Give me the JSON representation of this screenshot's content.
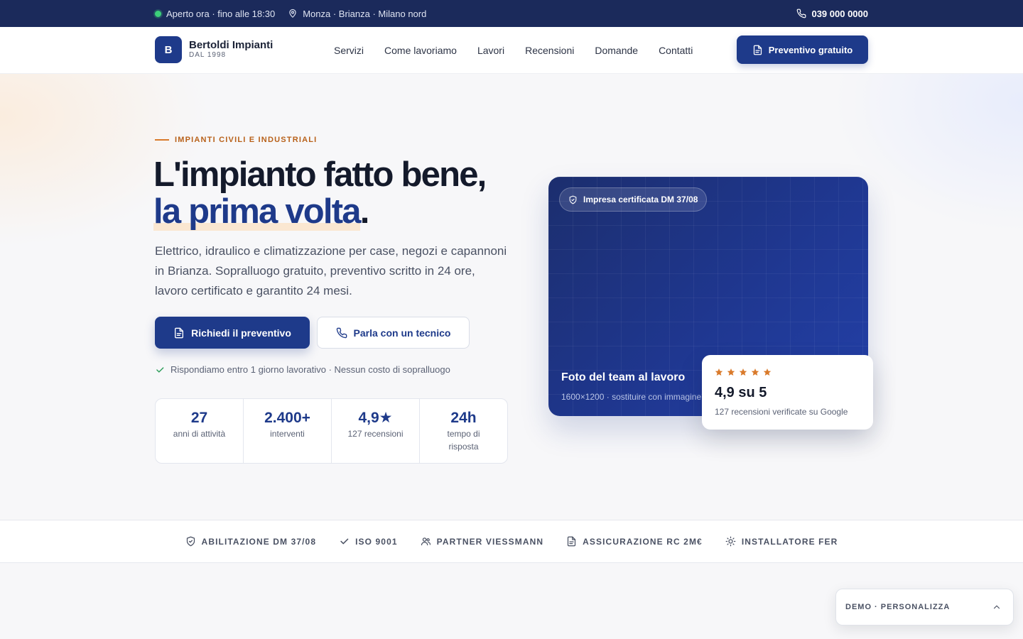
{
  "topbar": {
    "status": "Aperto ora · fino alle 18:30",
    "location": "Monza · Brianza · Milano nord",
    "phone": "039 000 0000"
  },
  "header": {
    "logo_letter": "B",
    "brand_name": "Bertoldi Impianti",
    "brand_since": "DAL 1998",
    "nav": [
      "Servizi",
      "Come lavoriamo",
      "Lavori",
      "Recensioni",
      "Domande",
      "Contatti"
    ],
    "cta": "Preventivo gratuito"
  },
  "hero": {
    "eyebrow": "IMPIANTI CIVILI E INDUSTRIALI",
    "title_line1": "L'impianto fatto bene,",
    "title_accent": "la prima volta",
    "title_end": ".",
    "lead": "Elettrico, idraulico e climatizzazione per case, negozi e capannoni in Brianza. Sopralluogo gratuito, preventivo scritto in 24 ore, lavoro certificato e garantito 24 mesi.",
    "btn_primary": "Richiedi il preventivo",
    "btn_secondary": "Parla con un tecnico",
    "note": "Rispondiamo entro 1 giorno lavorativo · Nessun costo di sopralluogo",
    "stats": [
      {
        "value": "27",
        "label": "anni di attività"
      },
      {
        "value": "2.400+",
        "label": "interventi"
      },
      {
        "value": "4,9★",
        "label": "127 recensioni"
      },
      {
        "value": "24h",
        "label": "tempo di risposta"
      }
    ]
  },
  "photo": {
    "badge": "Impresa certificata DM 37/08",
    "title": "Foto del team al lavoro",
    "subtitle": "1600×1200 · sostituire con immagine"
  },
  "review": {
    "score": "4,9 su 5",
    "subtitle": "127 recensioni verificate su Google",
    "stars": 5
  },
  "certs": [
    "ABILITAZIONE DM 37/08",
    "ISO 9001",
    "PARTNER VIESSMANN",
    "ASSICURAZIONE RC 2M€",
    "INSTALLATORE FER"
  ],
  "demo": {
    "label": "DEMO · PERSONALIZZA"
  },
  "colors": {
    "brand": "#1e3a8a",
    "topbar": "#1b2a5b",
    "accent": "#d97a2b",
    "status": "#3ccf7a"
  }
}
